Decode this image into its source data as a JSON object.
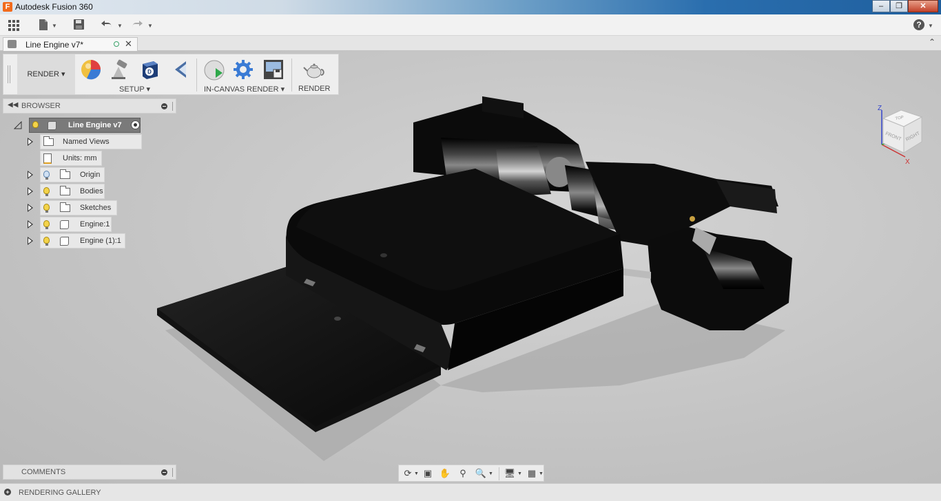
{
  "window": {
    "title": "Autodesk Fusion 360",
    "logo_letter": "F"
  },
  "qat": {
    "help": "?"
  },
  "document_tab": {
    "title": "Line Engine v7*"
  },
  "ribbon": {
    "workspace": "RENDER",
    "groups": [
      {
        "label": "SETUP"
      },
      {
        "label": "IN-CANVAS RENDER"
      },
      {
        "label": "RENDER"
      }
    ]
  },
  "browser": {
    "header": "BROWSER",
    "root": "Line Engine v7",
    "items": [
      {
        "label": "Named Views"
      },
      {
        "label": "Units: mm"
      },
      {
        "label": "Origin"
      },
      {
        "label": "Bodies"
      },
      {
        "label": "Sketches"
      },
      {
        "label": "Engine:1"
      },
      {
        "label": "Engine (1):1"
      }
    ]
  },
  "comments": {
    "header": "COMMENTS"
  },
  "gallery": {
    "label": "RENDERING GALLERY"
  },
  "viewcube": {
    "axis_z": "Z",
    "axis_x": "X",
    "face_front": "FRONT",
    "face_right": "RIGHT",
    "face_top": "TOP"
  },
  "colors": {
    "accent": "#f26b1d",
    "bulb_on": "#f3d34a",
    "bulb_off": "#cfe0f3",
    "model": "#0a0a0a"
  }
}
